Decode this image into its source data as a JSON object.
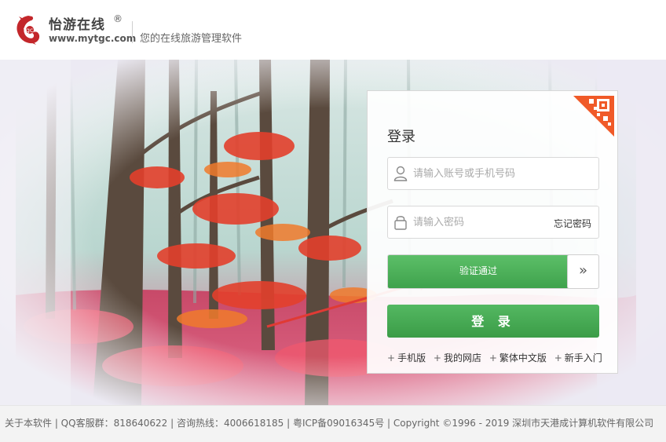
{
  "header": {
    "brand_name": "怡游在线",
    "registered_mark": "®",
    "website": "www.mytgc.com",
    "slogan": "您的在线旅游管理软件",
    "logo_icon": "mytgc-logo-icon",
    "brand_color": "#c3272b"
  },
  "banner": {
    "theme": "autumn-forest-background"
  },
  "login": {
    "title": "登录",
    "qr_icon": "qr-code-corner-icon",
    "account_placeholder": "请输入账号或手机号码",
    "account_value": "",
    "account_icon": "user-icon",
    "password_placeholder": "请输入密码",
    "password_value": "",
    "password_icon": "lock-icon",
    "forgot_password": "忘记密码",
    "verify_text": "验证通过",
    "verify_progress": 1.0,
    "verify_handle_icon": "double-chevron-right-icon",
    "submit_label": "登 录",
    "accent_color": "#45a952",
    "links": [
      {
        "plus": "+",
        "label": "手机版"
      },
      {
        "plus": "+",
        "label": "我的网店"
      },
      {
        "plus": "+",
        "label": "繁体中文版"
      },
      {
        "plus": "+",
        "label": "新手入门"
      }
    ]
  },
  "annotation": {
    "arrow_icon": "red-arrow-pointer",
    "arrow_color": "#e03a34"
  },
  "footer": {
    "text": "关于本软件 | QQ客服群：818640622 | 咨询热线：4006618185 | 粤ICP备09016345号 | Copyright ©1996 - 2019 深圳市天港成计算机软件有限公司"
  }
}
